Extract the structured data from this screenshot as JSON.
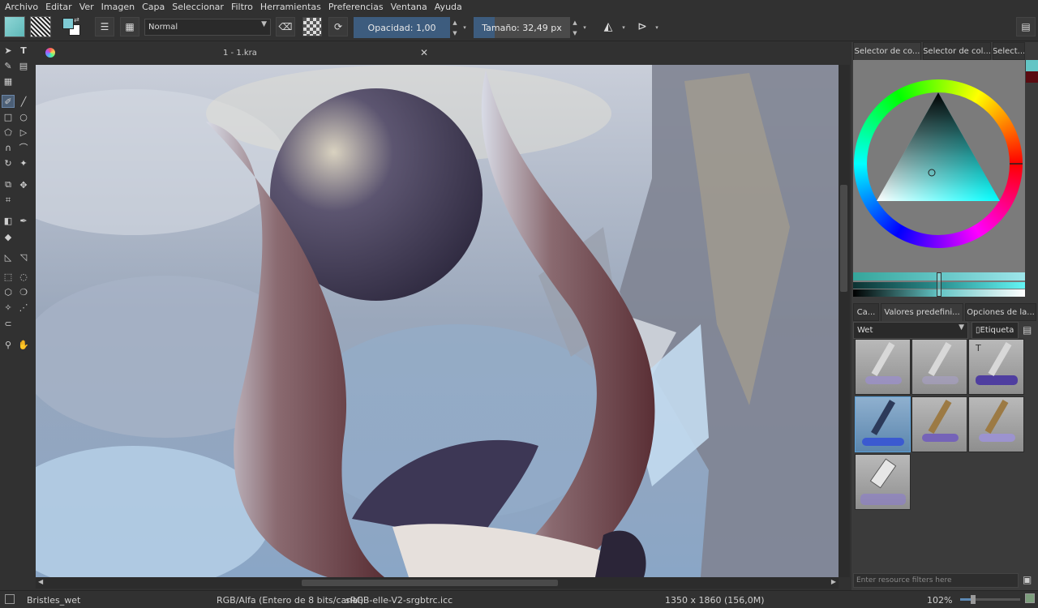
{
  "menu": {
    "items": [
      "Archivo",
      "Editar",
      "Ver",
      "Imagen",
      "Capa",
      "Seleccionar",
      "Filtro",
      "Herramientas",
      "Preferencias",
      "Ventana",
      "Ayuda"
    ]
  },
  "toolbar": {
    "blend_mode": "Normal",
    "opacity_label": "Opacidad:",
    "opacity_value": "1,00",
    "opacity_fraction": 1.0,
    "size_label": "Tamaño:",
    "size_value": "32,49 px",
    "size_fraction": 0.22,
    "foreground_color": "#7ecad3",
    "background_color": "#ffffff"
  },
  "document": {
    "tab_title": "1 - 1.kra"
  },
  "right_panel": {
    "top_tabs": [
      "Selector de co...",
      "Selector de col...",
      "Select..."
    ],
    "mid_tabs": [
      "Ca...",
      "Valores predefini...",
      "Opciones de la..."
    ],
    "preset_filter": "Wet",
    "tag_button": "Etiqueta",
    "filter_placeholder": "Enter resource filters here",
    "color_swatches": [
      "#63c5c5",
      "#5a0c12"
    ]
  },
  "status": {
    "brush_name": "Bristles_wet",
    "color_model": "RGB/Alfa (Entero de 8 bits/canal)",
    "color_profile": "sRGB-elle-V2-srgbtrc.icc",
    "image_size": "1350 x 1860 (156,0M)",
    "zoom": "102%",
    "zoom_fraction": 0.22
  },
  "icons": [
    "flip-horizontal-icon",
    "flip-vertical-icon",
    "eraser-icon",
    "alpha-lock-icon",
    "reload-icon",
    "settings-icon",
    "brush-icon",
    "pan-icon"
  ]
}
